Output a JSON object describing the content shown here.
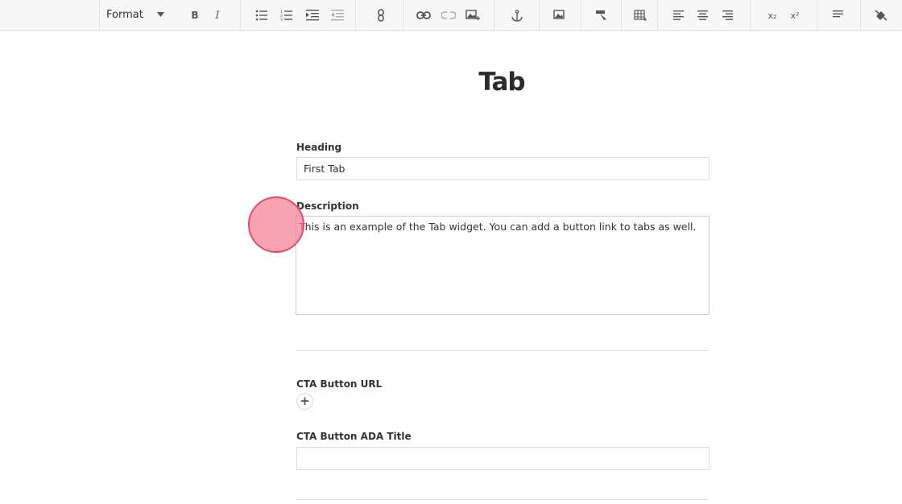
{
  "toolbar": {
    "format_label": "Format",
    "bold_label": "B",
    "italic_label": "I",
    "subscript_label": "x₂",
    "superscript_label": "x²"
  },
  "page": {
    "title": "Tab"
  },
  "form": {
    "heading_label": "Heading",
    "heading_value": "First Tab",
    "description_label": "Description",
    "description_value": "This is an example of the Tab widget. You can add a button link to tabs as well.",
    "cta_url_label": "CTA Button URL",
    "cta_add_label": "+",
    "cta_title_label": "CTA Button ADA Title",
    "cta_title_value": ""
  },
  "colors": {
    "toolbar_bg": "#f7f7f7",
    "click_marker": "#e9496b",
    "textarea_border": "#b9cfe3"
  }
}
